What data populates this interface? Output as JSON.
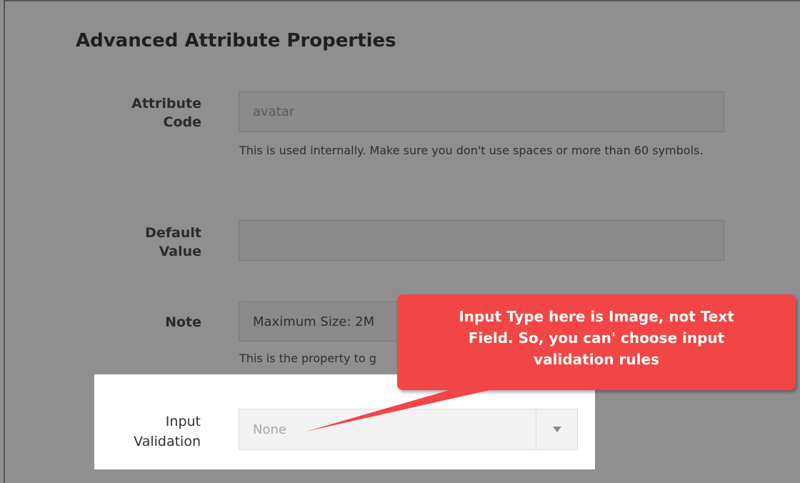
{
  "section": {
    "title": "Advanced Attribute Properties"
  },
  "attribute_code": {
    "label_line1": "Attribute",
    "label_line2": "Code",
    "value": "avatar",
    "hint": "This is used internally. Make sure you don't use spaces or more than 60 symbols."
  },
  "default_value": {
    "label_line1": "Default",
    "label_line2": "Value",
    "value": ""
  },
  "note": {
    "label": "Note",
    "value": "Maximum Size: 2M",
    "hint": "This is the property to g"
  },
  "input_validation": {
    "label_line1": "Input",
    "label_line2": "Validation",
    "selected": "None",
    "arrow_icon": "triangle-down-icon"
  },
  "callout": {
    "text": "Input Type here is Image, not Text Field. So, you can' choose input validation rules",
    "color": "#f24545"
  }
}
